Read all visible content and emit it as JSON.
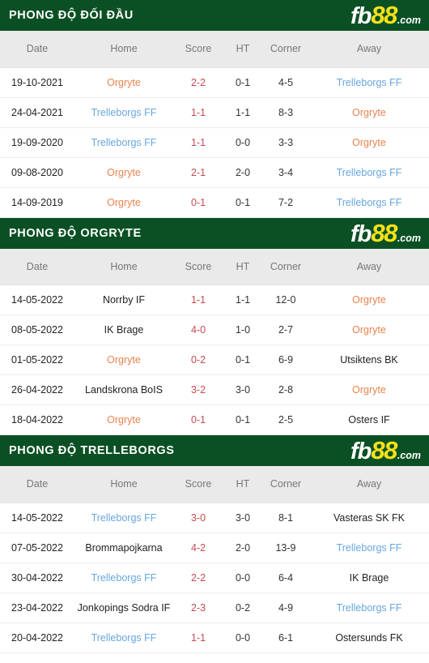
{
  "logo": {
    "part1": "fb",
    "part2": "88",
    "part3": ".com",
    "yellow": "#f5e119",
    "green": "#0b5024"
  },
  "colors": {
    "banner_green": "#0b5024",
    "header_gray": "#eaeaea",
    "score_red": "#c64a52",
    "orgryte_orange": "#e9834d",
    "trelleborgs_blue": "#67a6dd"
  },
  "columns": [
    "Date",
    "Home",
    "Score",
    "HT",
    "Corner",
    "Away"
  ],
  "sections": [
    {
      "title": "PHONG ĐỘ ĐỐI ĐẦU",
      "rows": [
        {
          "date": "19-10-2021",
          "home": "Orgryte",
          "home_style": "orgryte",
          "score": "2-2",
          "ht": "0-1",
          "corner": "4-5",
          "away": "Trelleborgs FF",
          "away_style": "trelleborgs"
        },
        {
          "date": "24-04-2021",
          "home": "Trelleborgs FF",
          "home_style": "trelleborgs",
          "score": "1-1",
          "ht": "1-1",
          "corner": "8-3",
          "away": "Orgryte",
          "away_style": "orgryte"
        },
        {
          "date": "19-09-2020",
          "home": "Trelleborgs FF",
          "home_style": "trelleborgs",
          "score": "1-1",
          "ht": "0-0",
          "corner": "3-3",
          "away": "Orgryte",
          "away_style": "orgryte"
        },
        {
          "date": "09-08-2020",
          "home": "Orgryte",
          "home_style": "orgryte",
          "score": "2-1",
          "ht": "2-0",
          "corner": "3-4",
          "away": "Trelleborgs FF",
          "away_style": "trelleborgs"
        },
        {
          "date": "14-09-2019",
          "home": "Orgryte",
          "home_style": "orgryte",
          "score": "0-1",
          "ht": "0-1",
          "corner": "7-2",
          "away": "Trelleborgs FF",
          "away_style": "trelleborgs"
        }
      ]
    },
    {
      "title": "PHONG ĐỘ ORGRYTE",
      "rows": [
        {
          "date": "14-05-2022",
          "home": "Norrby IF",
          "home_style": "plain",
          "score": "1-1",
          "ht": "1-1",
          "corner": "12-0",
          "away": "Orgryte",
          "away_style": "orgryte"
        },
        {
          "date": "08-05-2022",
          "home": "IK Brage",
          "home_style": "plain",
          "score": "4-0",
          "ht": "1-0",
          "corner": "2-7",
          "away": "Orgryte",
          "away_style": "orgryte"
        },
        {
          "date": "01-05-2022",
          "home": "Orgryte",
          "home_style": "orgryte",
          "score": "0-2",
          "ht": "0-1",
          "corner": "6-9",
          "away": "Utsiktens BK",
          "away_style": "plain"
        },
        {
          "date": "26-04-2022",
          "home": "Landskrona BoIS",
          "home_style": "plain",
          "score": "3-2",
          "ht": "3-0",
          "corner": "2-8",
          "away": "Orgryte",
          "away_style": "orgryte"
        },
        {
          "date": "18-04-2022",
          "home": "Orgryte",
          "home_style": "orgryte",
          "score": "0-1",
          "ht": "0-1",
          "corner": "2-5",
          "away": "Osters IF",
          "away_style": "plain"
        }
      ]
    },
    {
      "title": "PHONG ĐỘ TRELLEBORGS",
      "rows": [
        {
          "date": "14-05-2022",
          "home": "Trelleborgs FF",
          "home_style": "trelleborgs",
          "score": "3-0",
          "ht": "3-0",
          "corner": "8-1",
          "away": "Vasteras SK FK",
          "away_style": "plain"
        },
        {
          "date": "07-05-2022",
          "home": "Brommapojkarna",
          "home_style": "plain",
          "score": "4-2",
          "ht": "2-0",
          "corner": "13-9",
          "away": "Trelleborgs FF",
          "away_style": "trelleborgs"
        },
        {
          "date": "30-04-2022",
          "home": "Trelleborgs FF",
          "home_style": "trelleborgs",
          "score": "2-2",
          "ht": "0-0",
          "corner": "6-4",
          "away": "IK Brage",
          "away_style": "plain"
        },
        {
          "date": "23-04-2022",
          "home": "Jonkopings Sodra IF",
          "home_style": "plain",
          "score": "2-3",
          "ht": "0-2",
          "corner": "4-9",
          "away": "Trelleborgs FF",
          "away_style": "trelleborgs"
        },
        {
          "date": "20-04-2022",
          "home": "Trelleborgs FF",
          "home_style": "trelleborgs",
          "score": "1-1",
          "ht": "0-0",
          "corner": "6-1",
          "away": "Ostersunds FK",
          "away_style": "plain"
        }
      ]
    }
  ]
}
